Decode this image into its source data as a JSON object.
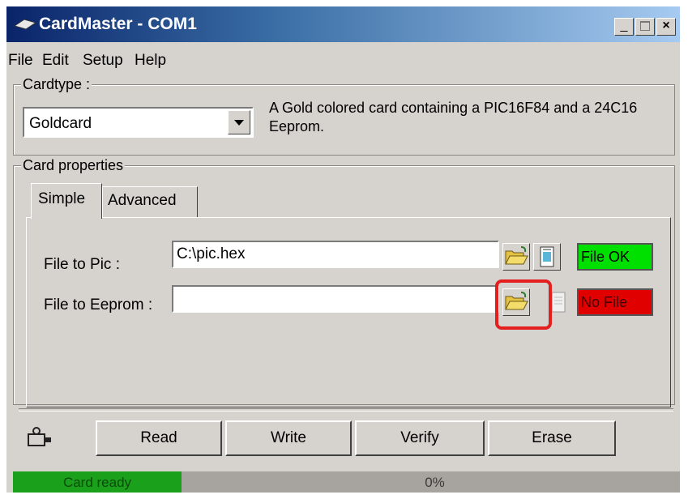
{
  "window": {
    "title": "CardMaster - COM1"
  },
  "menu": {
    "items": [
      "File",
      "Edit",
      "Setup",
      "Help"
    ]
  },
  "cardtype": {
    "legend": "Cardtype :",
    "selected": "Goldcard",
    "description": "A Gold colored card containing a PIC16F84 and a 24C16 Eeprom."
  },
  "properties": {
    "legend": "Card properties",
    "tabs": [
      "Simple",
      "Advanced"
    ]
  },
  "pic": {
    "label": "File to Pic :",
    "value": "C:\\pic.hex",
    "status": "File OK",
    "status_color": "#00e000"
  },
  "eeprom": {
    "label": "File to Eeprom :",
    "value": "",
    "status": "No File",
    "status_color": "#e00000"
  },
  "buttons": {
    "read": "Read",
    "write": "Write",
    "verify": "Verify",
    "erase": "Erase"
  },
  "statusbar": {
    "state": "Card ready",
    "progress": "0%"
  },
  "highlight_color": "#e41f1f"
}
